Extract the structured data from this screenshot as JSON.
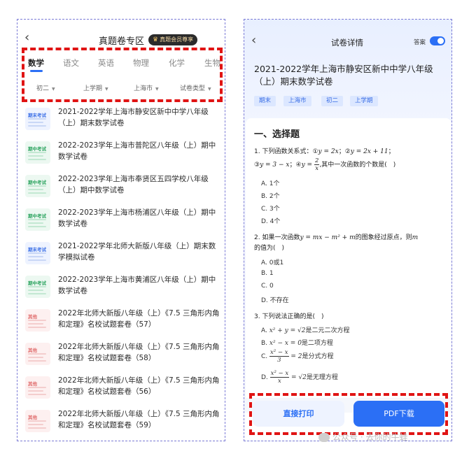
{
  "left": {
    "title": "真题卷专区",
    "vip_badge": "真题会员尊享",
    "tabs": [
      "数学",
      "语文",
      "英语",
      "物理",
      "化学",
      "生物"
    ],
    "filters": [
      "初二",
      "上学期",
      "上海市",
      "试卷类型"
    ],
    "items": [
      {
        "tag": "期末考试",
        "title": "2021-2022学年上海市静安区新中中学八年级（上）期末数学试卷",
        "color": "blue"
      },
      {
        "tag": "期中考试",
        "title": "2022-2023学年上海市普陀区八年级（上）期中数学试卷",
        "color": "green"
      },
      {
        "tag": "期中考试",
        "title": "2022-2023学年上海市奉贤区五四学校八年级（上）期中数学试卷",
        "color": "green"
      },
      {
        "tag": "期中考试",
        "title": "2022-2023学年上海市杨浦区八年级（上）期中数学试卷",
        "color": "green"
      },
      {
        "tag": "期末考试",
        "title": "2021-2022学年北师大新版八年级（上）期末数学模拟试卷",
        "color": "blue"
      },
      {
        "tag": "期中考试",
        "title": "2022-2023学年上海市黄浦区八年级（上）期中数学试卷",
        "color": "green"
      },
      {
        "tag": "其他",
        "title": "2022年北师大新版八年级（上）《7.5 三角形内角和定理》名校试题套卷（57）",
        "color": "red"
      },
      {
        "tag": "其他",
        "title": "2022年北师大新版八年级（上）《7.5 三角形内角和定理》名校试题套卷（58）",
        "color": "red"
      },
      {
        "tag": "其他",
        "title": "2022年北师大新版八年级（上）《7.5 三角形内角和定理》名校试题套卷（56）",
        "color": "red"
      },
      {
        "tag": "其他",
        "title": "2022年北师大新版八年级（上）《7.5 三角形内角和定理》名校试题套卷（59）",
        "color": "red"
      }
    ]
  },
  "right": {
    "title": "试卷详情",
    "answer_label": "答案",
    "paper_title": "2021-2022学年上海市静安区新中中学八年级（上）期末数学试卷",
    "tags": [
      "期末",
      "上海市",
      "初二",
      "上学期"
    ],
    "section": "一、选择题",
    "q1": {
      "text": "1. 下列函数关系式：①",
      "eq1": "y = 2x",
      "sep1": "；②",
      "eq2": "y = 2x + 11",
      "sep2": "；",
      "line2a": "③",
      "eq3": "y = 3 − x",
      "sep3": "；④",
      "eq4a": "y = ",
      "frac_num": "2",
      "frac_den": "x",
      "tail": ",其中一次函数的个数是(　)",
      "options": [
        "A. 1个",
        "B. 2个",
        "C. 3个",
        "D. 4个"
      ]
    },
    "q2": {
      "text": "2. 如果一次函数",
      "eq": "y = mx − m² + m",
      "tail": "的图象经过原点，则",
      "var": "m",
      "line2": "的值为(　)",
      "options": [
        "A. 0或1",
        "B. 1",
        "C. 0",
        "D. 不存在"
      ]
    },
    "q3": {
      "text": "3. 下列说法正确的是(　)",
      "a_prefix": "A. ",
      "a_eq": "x² + y = √2",
      "a_tail": "是二元二次方程",
      "b_prefix": "B. ",
      "b_eq": "x² − x = 0",
      "b_tail": "是二项方程",
      "c_prefix": "C. ",
      "c_num": "x² − x",
      "c_den": "3",
      "c_eq": " = 2",
      "c_tail": "是分式方程",
      "d_prefix": "D. ",
      "d_num": "x² − x",
      "d_den": "x",
      "d_eq": " = √2",
      "d_tail": "是无理方程"
    },
    "print_button": "直接打印",
    "pdf_button": "PDF下载"
  },
  "watermark": "公众号 · 去你的牛蛙",
  "colors": {
    "accent": "#2b6ff5",
    "highlight_border": "#e01414",
    "frame_border": "#7b7bd6"
  }
}
